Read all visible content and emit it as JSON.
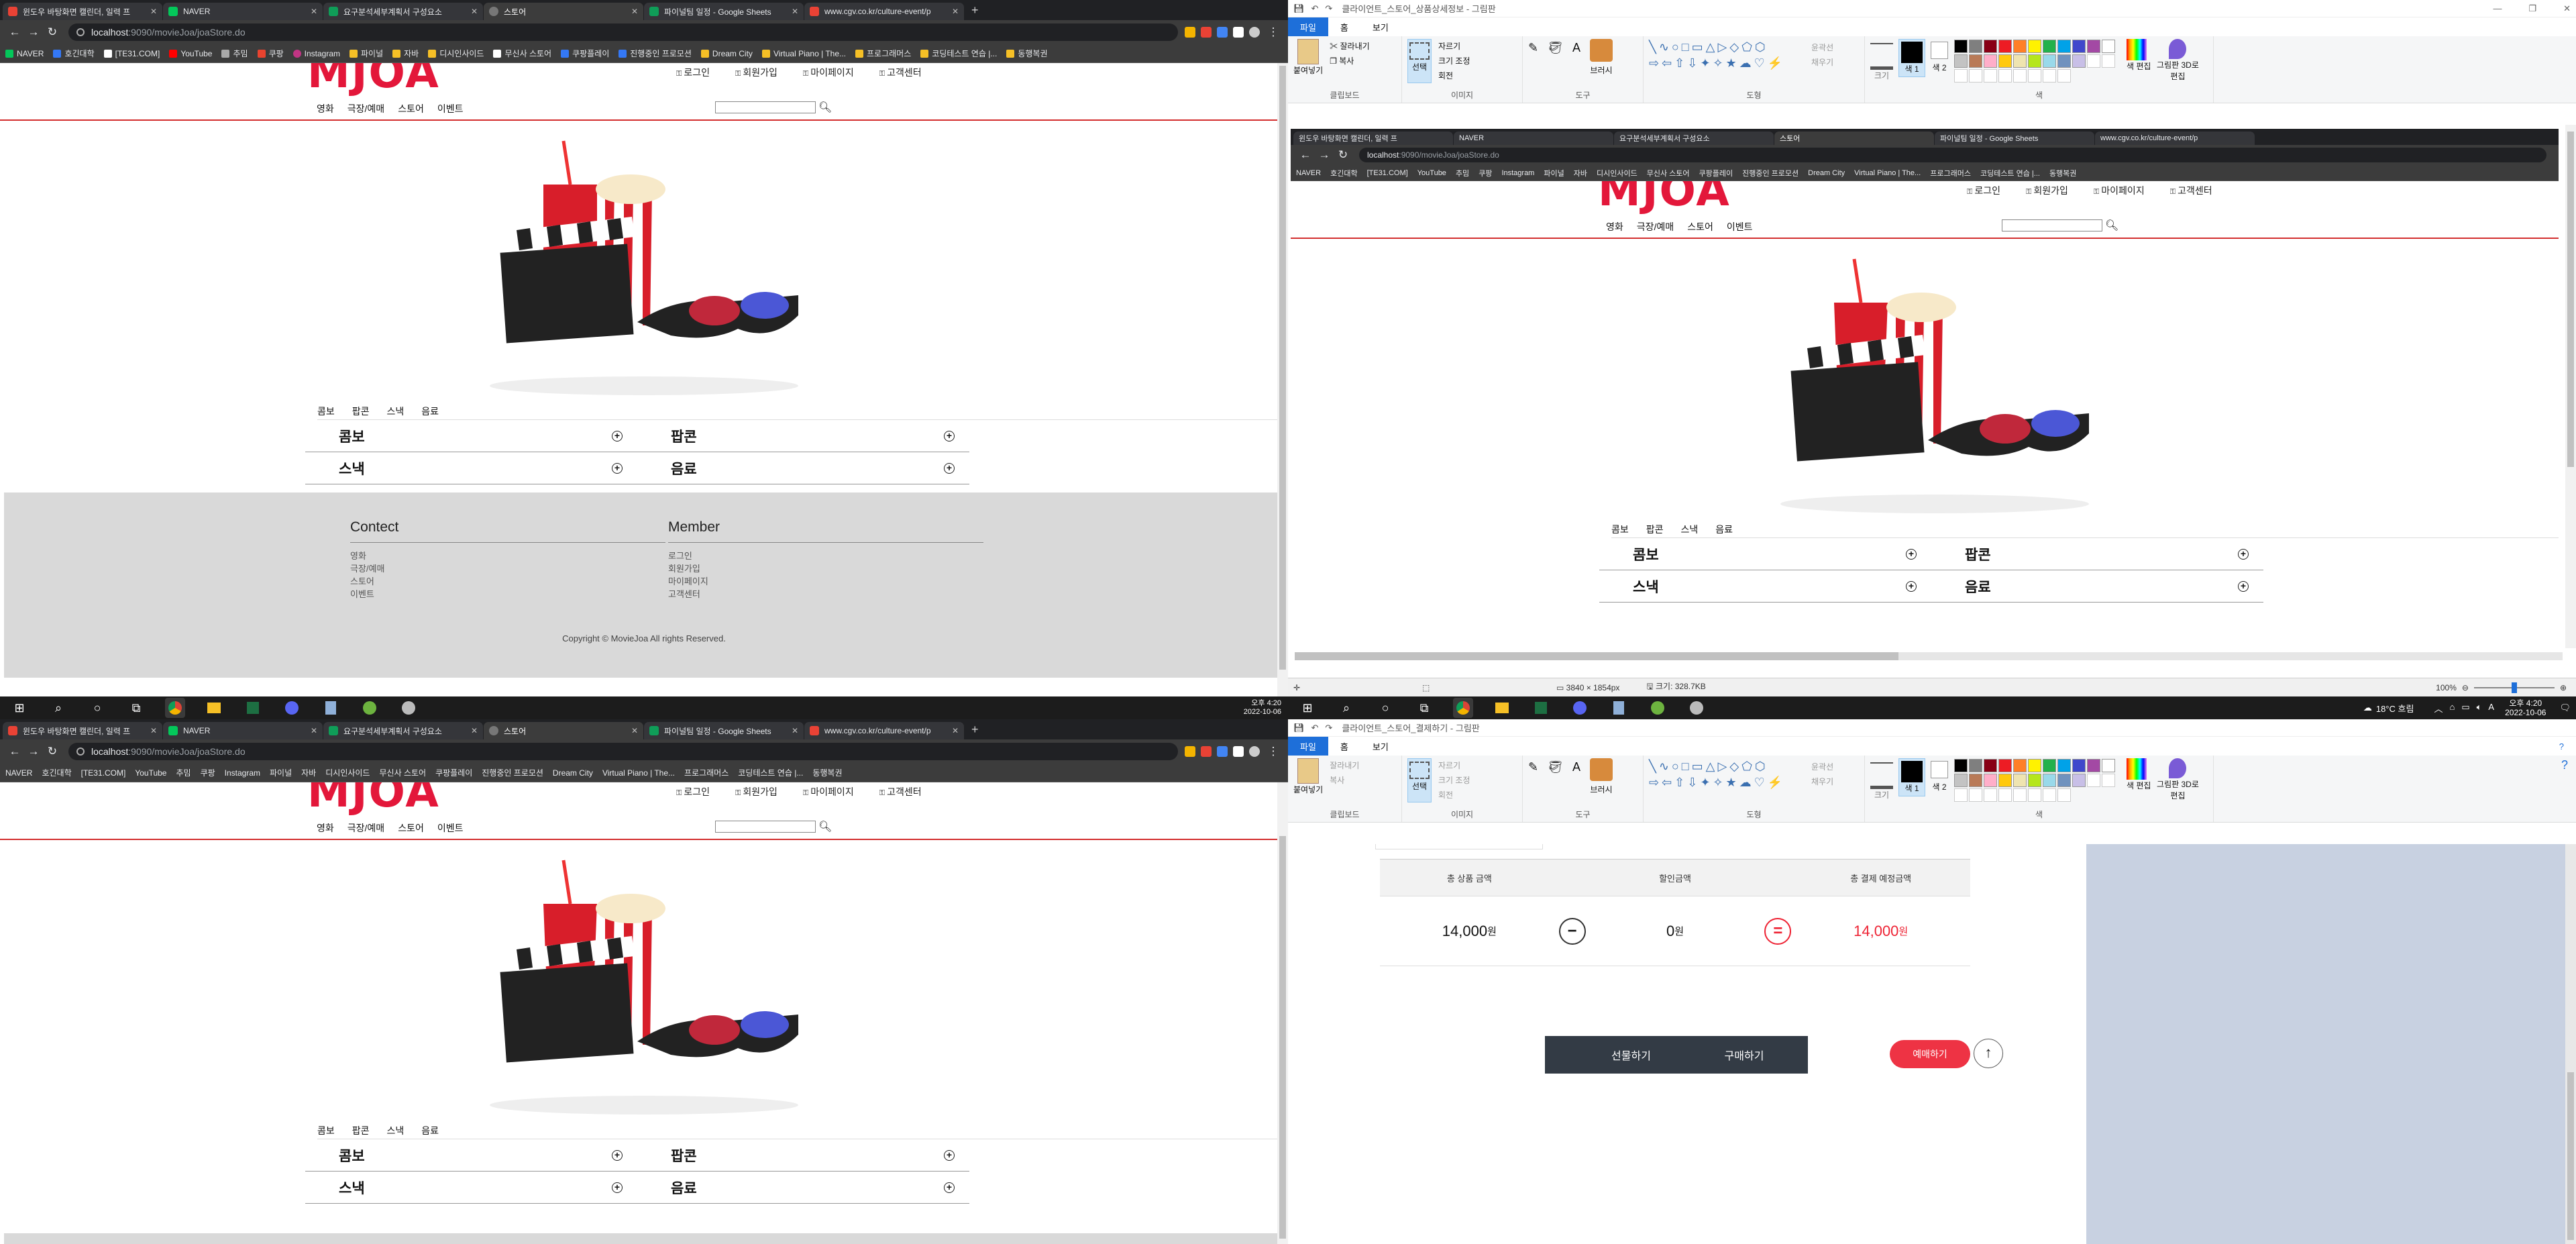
{
  "browser": {
    "tabs": [
      "윈도우 바탕화면 캘린더, 일력 프",
      "NAVER",
      "요구분석세부계획서 구성요소",
      "스토어",
      "파이널팀 일정 - Google Sheets",
      "www.cgv.co.kr/culture-event/p"
    ],
    "new_tab": "+",
    "url_host": "localhost",
    "url_path": ":9090/movieJoa/joaStore.do",
    "bookmarks": [
      "NAVER",
      "호긴대학",
      "[TE31.COM]",
      "YouTube",
      "추밈",
      "쿠팡",
      "Instagram",
      "파이널",
      "자바",
      "디시인사이드",
      "무신사 스토어",
      "쿠팡플레이",
      "진행중인 프로모션",
      "Dream City",
      "Virtual Piano | The...",
      "프로그래머스",
      "코딩테스트 연습 |...",
      "동행복권"
    ]
  },
  "site": {
    "logo": "MJOA",
    "util_links": [
      "로그인",
      "회원가입",
      "마이페이지",
      "고객센터"
    ],
    "menu": [
      "영화",
      "극장/예매",
      "스토어",
      "이벤트"
    ],
    "subtabs": [
      "콤보",
      "팝콘",
      "스낵",
      "음료"
    ],
    "grid": [
      "콤보",
      "팝콘",
      "스낵",
      "음료"
    ],
    "footer": {
      "col1_title": "Contect",
      "col1_links": [
        "영화",
        "극장/예매",
        "스토어",
        "이벤트"
      ],
      "col2_title": "Member",
      "col2_links": [
        "로그인",
        "회원가입",
        "마이페이지",
        "고객센터"
      ],
      "copyright": "Copyright © MovieJoa All rights Reserved."
    }
  },
  "paint": {
    "title_top": "클라이언트_스토어_상품상세정보 - 그림판",
    "title_bottom": "클라이언트_스토어_결제하기 - 그림판",
    "menu": [
      "파일",
      "홈",
      "보기"
    ],
    "groups": [
      "클립보드",
      "이미지",
      "도구",
      "도형",
      "색"
    ],
    "tools": {
      "paste": "붙여넣기",
      "cut": "잘라내기",
      "copy": "복사",
      "select": "선택",
      "crop": "자르기",
      "resize": "크기 조정",
      "rotate": "회전",
      "brush": "브러시",
      "outline": "윤곽선",
      "fill": "채우기",
      "size": "크기",
      "color1": "색 1",
      "color2": "색 2",
      "edit_colors": "색 편집",
      "paint3d": "그림판 3D로 편집"
    },
    "status_dims": "3840 × 1854px",
    "status_size": "크기: 328.7KB",
    "zoom": "100%",
    "palette": [
      "#000000",
      "#7f7f7f",
      "#880015",
      "#ed1c24",
      "#ff7f27",
      "#fff200",
      "#22b14c",
      "#00a2e8",
      "#3f48cc",
      "#a349a4",
      "#ffffff",
      "#c3c3c3",
      "#b97a57",
      "#ffaec9",
      "#ffc90e",
      "#efe4b0",
      "#b5e61d",
      "#99d9ea",
      "#7092be",
      "#c8bfe7"
    ]
  },
  "payment": {
    "headers": [
      "총 상품 금액",
      "할인금액",
      "총 결제 예정금액"
    ],
    "total": "14,000",
    "discount": "0",
    "final": "14,000",
    "won": "원",
    "gift_button": "선물하기",
    "buy_button": "구매하기",
    "book_button": "예매하기"
  },
  "taskbar": {
    "weather": "18°C 흐림",
    "time": "오후 4:20",
    "date": "2022-10-06"
  }
}
